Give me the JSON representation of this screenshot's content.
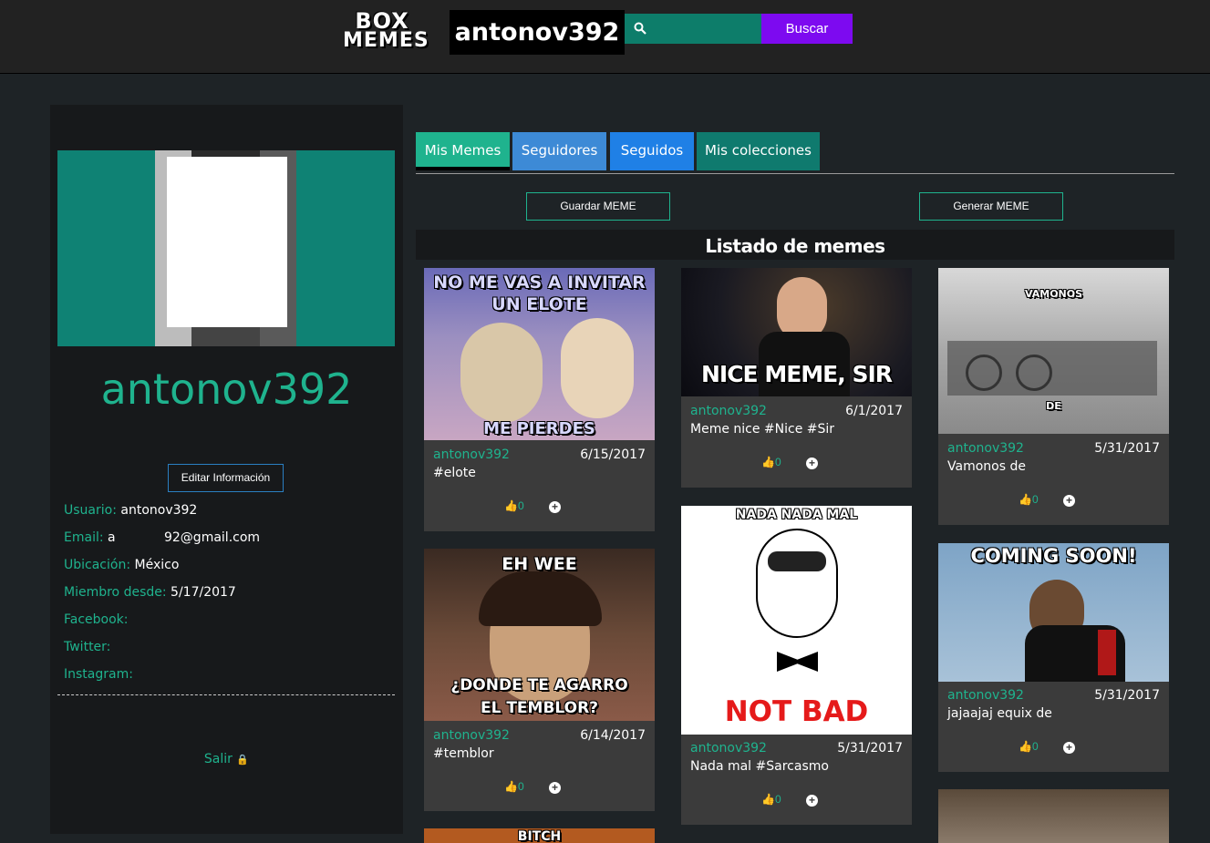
{
  "header": {
    "logo_line1": "BOX",
    "logo_line2": "MEMES",
    "username": "antonov392",
    "search_placeholder": "",
    "search_button": "Buscar"
  },
  "profile": {
    "name": "antonov392",
    "edit_button": "Editar Información",
    "fields": [
      {
        "label": "Usuario:",
        "value": "antonov392"
      },
      {
        "label": "Email:",
        "value": "a            92@gmail.com"
      },
      {
        "label": "Ubicación:",
        "value": "México"
      },
      {
        "label": "Miembro desde:",
        "value": "5/17/2017"
      },
      {
        "label": "Facebook:",
        "value": ""
      },
      {
        "label": "Twitter:",
        "value": ""
      },
      {
        "label": "Instagram:",
        "value": ""
      }
    ],
    "logout": "Salir"
  },
  "tabs": [
    {
      "label": "Mis Memes",
      "color": "#1fb38e"
    },
    {
      "label": "Seguidores",
      "color": "#3d8ad6"
    },
    {
      "label": "Seguidos",
      "color": "#1f80e6"
    },
    {
      "label": "Mis colecciones",
      "color": "#0f7a6e"
    }
  ],
  "actions": {
    "save": "Guardar MEME",
    "generate": "Generar MEME"
  },
  "list_title": "Listado de memes",
  "memes": [
    {
      "user": "antonov392",
      "date": "6/15/2017",
      "desc": "#elote",
      "likes": "0",
      "top": "NO ME VAS A INVITAR UN ELOTE",
      "bottom": "ME PIERDES"
    },
    {
      "user": "antonov392",
      "date": "6/14/2017",
      "desc": "#temblor",
      "likes": "0",
      "top": "EH WEE",
      "bottom": "¿DONDE TE AGARRO EL TEMBLOR?"
    },
    {
      "user": "antonov392",
      "date": "6/1/2017",
      "desc": "Meme nice #Nice #Sir",
      "likes": "0",
      "top": "",
      "bottom": "NICE MEME, SIR"
    },
    {
      "user": "antonov392",
      "date": "5/31/2017",
      "desc": "Nada mal #Sarcasmo",
      "likes": "0",
      "top": "NADA NADA MAL",
      "bottom": "NOT BAD"
    },
    {
      "user": "antonov392",
      "date": "5/31/2017",
      "desc": "Vamonos de",
      "likes": "0",
      "top": "VAMONOS",
      "bottom": "DE"
    },
    {
      "user": "antonov392",
      "date": "5/31/2017",
      "desc": "jajaajaj equix de",
      "likes": "0",
      "top": "COMING SOON!",
      "bottom": ""
    },
    {
      "top": "BITCH"
    }
  ]
}
